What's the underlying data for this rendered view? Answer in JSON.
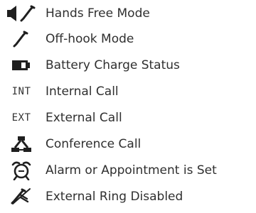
{
  "icon_legend": {
    "items": [
      {
        "icon": "speaker-handset-icon",
        "label": "Hands Free Mode"
      },
      {
        "icon": "handset-icon",
        "label": "Off-hook Mode"
      },
      {
        "icon": "battery-icon",
        "label": "Battery Charge Status"
      },
      {
        "icon": "int-text-icon",
        "icon_text": "INT",
        "label": "Internal Call"
      },
      {
        "icon": "ext-text-icon",
        "icon_text": "EXT",
        "label": "External Call"
      },
      {
        "icon": "conference-icon",
        "label": "Conference Call"
      },
      {
        "icon": "alarm-clock-icon",
        "label": "Alarm or Appointment is Set"
      },
      {
        "icon": "ringer-off-icon",
        "label": "External Ring Disabled"
      }
    ]
  }
}
